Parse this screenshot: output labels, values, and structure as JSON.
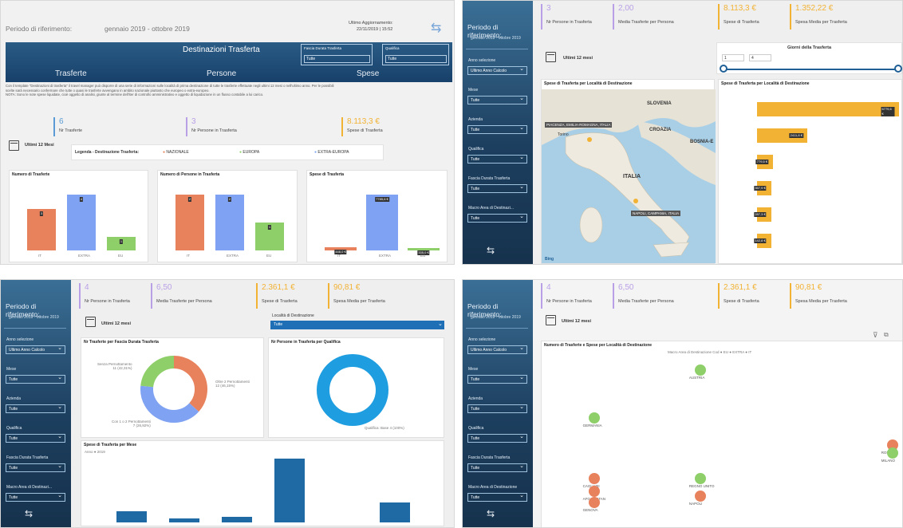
{
  "q1": {
    "period_label": "Periodo di riferimento:",
    "period_value": "gennaio 2019 - ottobre 2019",
    "update_label": "Ultimo Aggiornamento:",
    "update_value": "22/11/2019 | 15:52",
    "banner_title": "Destinazioni Trasferta",
    "tab_trasferte": "Trasferte",
    "tab_persone": "Persone",
    "tab_spese": "Spese",
    "filter1_label": "Fascia Durata Trasferta",
    "filter1_value": "Tutte",
    "filter2_label": "Qualifica",
    "filter2_value": "Tutte",
    "desc1": "Con il template \"Destinazioni di trasferta\" il travel manager può disporre di una serie di informazioni sulle località di prima destinazione di tutte le trasferte effettuate negli ultimi 12 mesi o nell'ultimo anno. Per le possibili",
    "desc2": "scelte sarà necessario confermare che tutte o quasi le trasferte avvengano in ambito nazionale piuttosto che europeo o extra-europeo.",
    "desc3": "NOTA: Sono le note spese liquidate, cioè oggetto di analisi, giunte al termine dell'iter di controllo amministrativo e oggetto di liquidazione in un flusso contabile a lui carico.",
    "kpi1_value": "6",
    "kpi1_label": "Nr Trasferte",
    "kpi2_value": "3",
    "kpi2_label": "Nr Persone in Trasferta",
    "kpi3_value": "8.113,3 €",
    "kpi3_label": "Spese di Trasferta",
    "last12": "Ultimi 12 Mesi",
    "legend_title": "Legenda - Destinazione Trasferta:",
    "legend": [
      "NAZIONALE",
      "EUROPA",
      "EXTRA-EUROPA"
    ],
    "colors": {
      "naz": "#e8825d",
      "eur": "#7fa3f2",
      "ext": "#8fcf6a",
      "kpi1": "#5b9bd5",
      "kpi2": "#b9a0e6",
      "kpi3": "#f2b233"
    },
    "charts": [
      {
        "title": "Numero di Trasferte",
        "chart_data": {
          "type": "bar",
          "categories": [
            "IT",
            "EXTRA",
            "EU"
          ],
          "values": [
            3,
            4,
            1
          ],
          "labels": [
            "3",
            "4",
            "1"
          ]
        }
      },
      {
        "title": "Numero di Persone in Trasferta",
        "chart_data": {
          "type": "bar",
          "categories": [
            "IT",
            "EXTRA",
            "EU"
          ],
          "values": [
            2,
            2,
            1
          ],
          "labels": [
            "2",
            "2",
            "1"
          ]
        }
      },
      {
        "title": "Spese di Trasferta",
        "chart_data": {
          "type": "bar",
          "categories": [
            "IT",
            "EXTRA",
            "EU"
          ],
          "values": [
            448,
            7785,
            335
          ],
          "labels": [
            "448,0 €",
            "7785,6 €",
            "335,0 €"
          ]
        }
      }
    ]
  },
  "q2": {
    "side": {
      "period_label": "Periodo di riferimento:",
      "period_value": "gennaio 2019 - ottobre 2019",
      "filters": [
        {
          "label": "Anno selezione",
          "value": "Ultimo Anno Calcolo"
        },
        {
          "label": "Mese",
          "value": "Tutte"
        },
        {
          "label": "Azienda",
          "value": "Tutte"
        },
        {
          "label": "Qualifica",
          "value": "Tutte"
        },
        {
          "label": "Fascia Durata Trasferta",
          "value": "Tutte"
        },
        {
          "label": "Macro Area di Destinazi...",
          "value": "Tutte"
        }
      ]
    },
    "kpis": [
      {
        "value": "3",
        "label": "Nr Persone in Trasferta"
      },
      {
        "value": "2,00",
        "label": "Media Trasferte per Persona"
      },
      {
        "value": "8.113,3 €",
        "label": "Spese di Trasferta"
      },
      {
        "value": "1.352,22 €",
        "label": "Spesa Media per Trasferta"
      }
    ],
    "last12": "Ultimi 12 mesi",
    "slider_title": "Giorni della Trasferta",
    "slider_min": "1",
    "slider_max": "4",
    "map_title": "Spese di Trasferta per Località di Destinazione",
    "map_labels": [
      "SLOVENIA",
      "CROAZIA",
      "BOSNIA-E",
      "ITALIA",
      "PIACENZA, EMILIA-ROMAGNA, ITALIA",
      "NAPOLI, CAMPANIA, ITALIA",
      "Torino",
      "Bing"
    ],
    "bars_title": "Spese di Trasferta per Località di Destinazione",
    "chart_data": {
      "type": "bar",
      "orientation": "horizontal",
      "values": [
        6779.6,
        2411.8,
        779.5,
        357.9,
        287.3,
        142.8
      ],
      "labels": [
        "6779,6 €",
        "2411,8 €",
        "779,5 €",
        "357,9 €",
        "287,3 €",
        "142,8 €"
      ]
    }
  },
  "q3": {
    "side": {
      "period_label": "Periodo di riferimento:",
      "period_value": "gennaio 2019 - ottobre 2019",
      "filters": [
        {
          "label": "Anno selezione",
          "value": "Ultimo Anno Calcolo"
        },
        {
          "label": "Mese",
          "value": "Tutte"
        },
        {
          "label": "Azienda",
          "value": "Tutte"
        },
        {
          "label": "Qualifica",
          "value": "Tutte"
        },
        {
          "label": "Fascia Durata Trasferta",
          "value": "Tutte"
        },
        {
          "label": "Macro Area di Destinazi...",
          "value": "Tutte"
        }
      ]
    },
    "kpis": [
      {
        "value": "4",
        "label": "Nr Persone in Trasferta"
      },
      {
        "value": "6,50",
        "label": "Media Trasferte per Persona"
      },
      {
        "value": "2.361,1 €",
        "label": "Spese di Trasferta"
      },
      {
        "value": "90,81 €",
        "label": "Spesa Media per Trasferta"
      }
    ],
    "last12": "Ultimi 12 mesi",
    "loc_label": "Località di Destinazione",
    "loc_value": "Tutte",
    "donut1_title": "Nr Trasferte per Fascia Durata Trasferta",
    "donut1_labels": [
      "Senza Pernottamento\n11 (42,31%)",
      "Oltre 2 Pernottamenti\n12 (46,15%)",
      "Con 1 o 2 Pernottamenti\n7 (26,92%)"
    ],
    "donut1_data": {
      "type": "pie",
      "values": [
        11,
        12,
        7
      ],
      "colors": [
        "#e8825d",
        "#7fa3f2",
        "#8fcf6a"
      ]
    },
    "donut2_title": "Nr Persone in Trasferta per Qualifica",
    "donut2_label": "Qualifica: Base 4 (100%)",
    "bar_title": "Spese di Trasferta per Mese",
    "bar_legend": "Anno ● 2019",
    "chart_data": {
      "type": "bar",
      "values": [
        170,
        60,
        90,
        1000,
        0,
        310
      ]
    }
  },
  "q4": {
    "side": {
      "period_label": "Periodo di riferimento:",
      "period_value": "gennaio 2019 - ottobre 2019",
      "filters": [
        {
          "label": "Anno selezione",
          "value": "Ultimo Anno Calcolo"
        },
        {
          "label": "Mese",
          "value": "Tutte"
        },
        {
          "label": "Azienda",
          "value": "Tutte"
        },
        {
          "label": "Qualifica",
          "value": "Tutte"
        },
        {
          "label": "Fascia Durata Trasferta",
          "value": "Tutte"
        },
        {
          "label": "Macro Area di Destinazione",
          "value": "Tutte"
        }
      ]
    },
    "kpis": [
      {
        "value": "4",
        "label": "Nr Persone in Trasferta"
      },
      {
        "value": "6,50",
        "label": "Media Trasferte per Persona"
      },
      {
        "value": "2.361,1 €",
        "label": "Spese di Trasferta"
      },
      {
        "value": "90,81 €",
        "label": "Spesa Media per Trasferta"
      }
    ],
    "last12": "Ultimi 12 mesi",
    "scatter_title": "Numero di Trasferte e Spese per Località di Destinazione",
    "scatter_legend": "Macro Area di Destinazione Cod ● EU ● EXTRA ● IT",
    "chart_data": {
      "type": "scatter",
      "points": [
        {
          "label": "AUSTRIA",
          "x": 0.43,
          "y": 0.92,
          "c": "#8fcf6a"
        },
        {
          "label": "GERMANIA",
          "x": 0.12,
          "y": 0.62,
          "c": "#8fcf6a"
        },
        {
          "label": "REGNO UNITO",
          "x": 0.43,
          "y": 0.24,
          "c": "#8fcf6a"
        },
        {
          "label": "NAPOLI",
          "x": 0.43,
          "y": 0.13,
          "c": "#e8825d"
        },
        {
          "label": "CAGLIARI",
          "x": 0.12,
          "y": 0.24,
          "c": "#e8825d"
        },
        {
          "label": "AFGANISTAN",
          "x": 0.12,
          "y": 0.16,
          "c": "#e8825d"
        },
        {
          "label": "GENOVA",
          "x": 0.12,
          "y": 0.09,
          "c": "#e8825d"
        },
        {
          "label": "ROMA",
          "x": 0.99,
          "y": 0.45,
          "c": "#e8825d"
        },
        {
          "label": "MILANO",
          "x": 0.99,
          "y": 0.4,
          "c": "#8fcf6a"
        }
      ]
    }
  }
}
